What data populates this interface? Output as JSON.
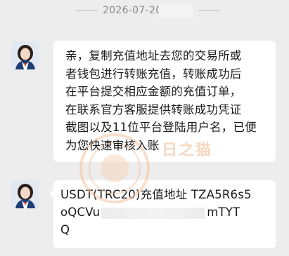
{
  "timestamp": {
    "date": "2026-07-20"
  },
  "messages": [
    {
      "sender_avatar": "agent-avatar",
      "lines": [
        "亲，复制充值地址去您的交易所或",
        "者钱包进行转账充值，转账成功后",
        "在平台提交相应金额的充值订单，",
        "在联系官方客服提供转账成功凭证",
        "截图以及11位平台登陆用户名，已便",
        "为您快速审核入账"
      ]
    },
    {
      "sender_avatar": "agent-avatar",
      "line1": "USDT(TRC20)充值地址 TZA5R6s5",
      "line2_start": "oQCVu",
      "line2_end": "mTYT",
      "line3": "Q"
    }
  ],
  "watermark": {
    "text": "日之猫"
  },
  "colors": {
    "background": "#ededed",
    "bubble": "#ffffff",
    "timestamp_text": "#8a8a8a"
  }
}
